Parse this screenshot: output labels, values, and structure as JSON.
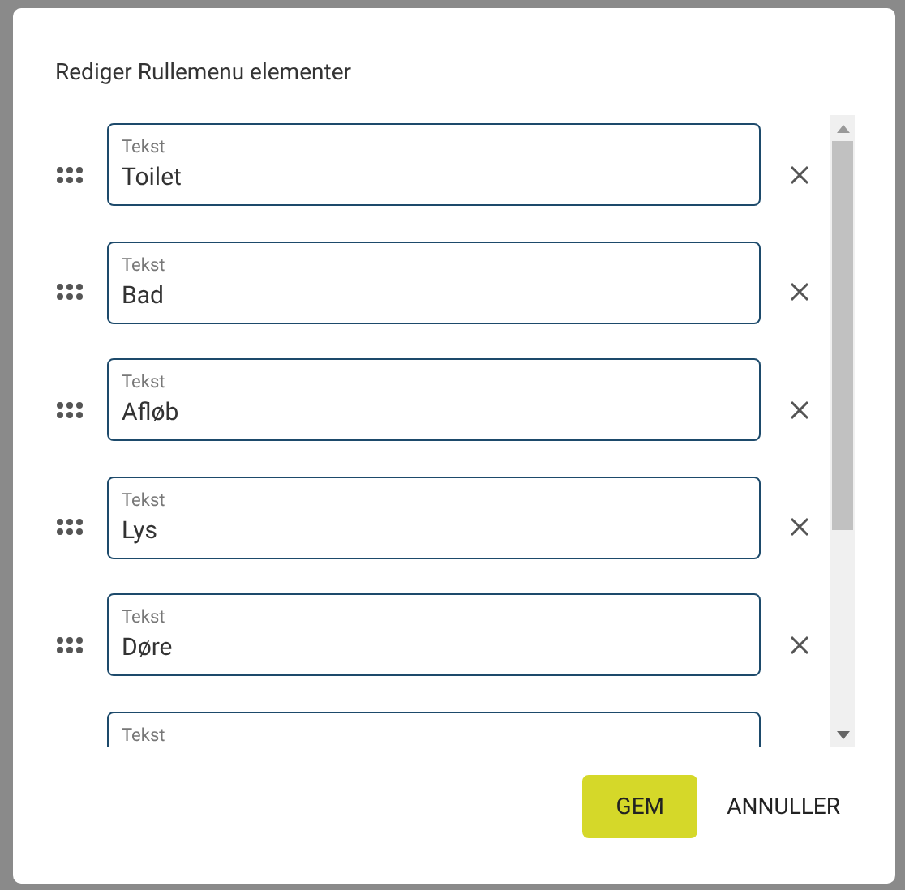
{
  "dialog": {
    "title": "Rediger Rullemenu elementer",
    "items": [
      {
        "label": "Tekst",
        "value": "Toilet"
      },
      {
        "label": "Tekst",
        "value": "Bad"
      },
      {
        "label": "Tekst",
        "value": "Afløb"
      },
      {
        "label": "Tekst",
        "value": "Lys"
      },
      {
        "label": "Tekst",
        "value": "Døre"
      },
      {
        "label": "Tekst"
      }
    ],
    "buttons": [
      {
        "label": "GEM",
        "kind": "primary"
      },
      {
        "label": "ANNULLER",
        "kind": "text"
      }
    ]
  }
}
